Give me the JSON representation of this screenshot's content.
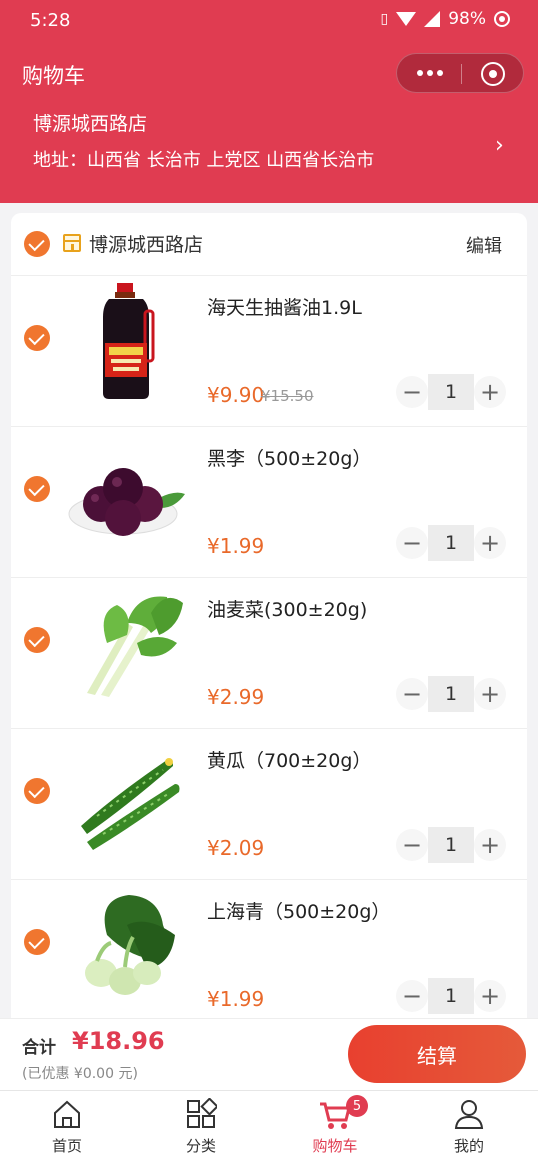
{
  "status": {
    "time": "5:28",
    "battery": "98%"
  },
  "header": {
    "title": "购物车",
    "store_name": "博源城西路店",
    "address_label": "地址：",
    "address": "山西省 长治市 上党区 山西省长治市"
  },
  "cart": {
    "store_name": "博源城西路店",
    "edit_label": "编辑",
    "items": [
      {
        "name": "海天生抽酱油1.9L",
        "price": "¥9.90",
        "original_price": "¥15.50",
        "quantity": "1"
      },
      {
        "name": "黑李（500±20g）",
        "price": "¥1.99",
        "original_price": "",
        "quantity": "1"
      },
      {
        "name": "油麦菜(300±20g)",
        "price": "¥2.99",
        "original_price": "",
        "quantity": "1"
      },
      {
        "name": "黄瓜（700±20g）",
        "price": "¥2.09",
        "original_price": "",
        "quantity": "1"
      },
      {
        "name": "上海青（500±20g）",
        "price": "¥1.99",
        "original_price": "",
        "quantity": "1"
      }
    ]
  },
  "summary": {
    "total_label": "合计",
    "total_value": "¥18.96",
    "discount_text": "(已优惠 ¥0.00 元)",
    "checkout_label": "结算"
  },
  "tabbar": {
    "tabs": [
      {
        "label": "首页",
        "icon": "home-icon"
      },
      {
        "label": "分类",
        "icon": "category-icon"
      },
      {
        "label": "购物车",
        "icon": "cart-icon",
        "badge": "5"
      },
      {
        "label": "我的",
        "icon": "user-icon"
      }
    ],
    "active_color": "#e03c51"
  },
  "colors": {
    "accent": "#e03c51",
    "price": "#e9692a",
    "check": "#f0762f"
  }
}
